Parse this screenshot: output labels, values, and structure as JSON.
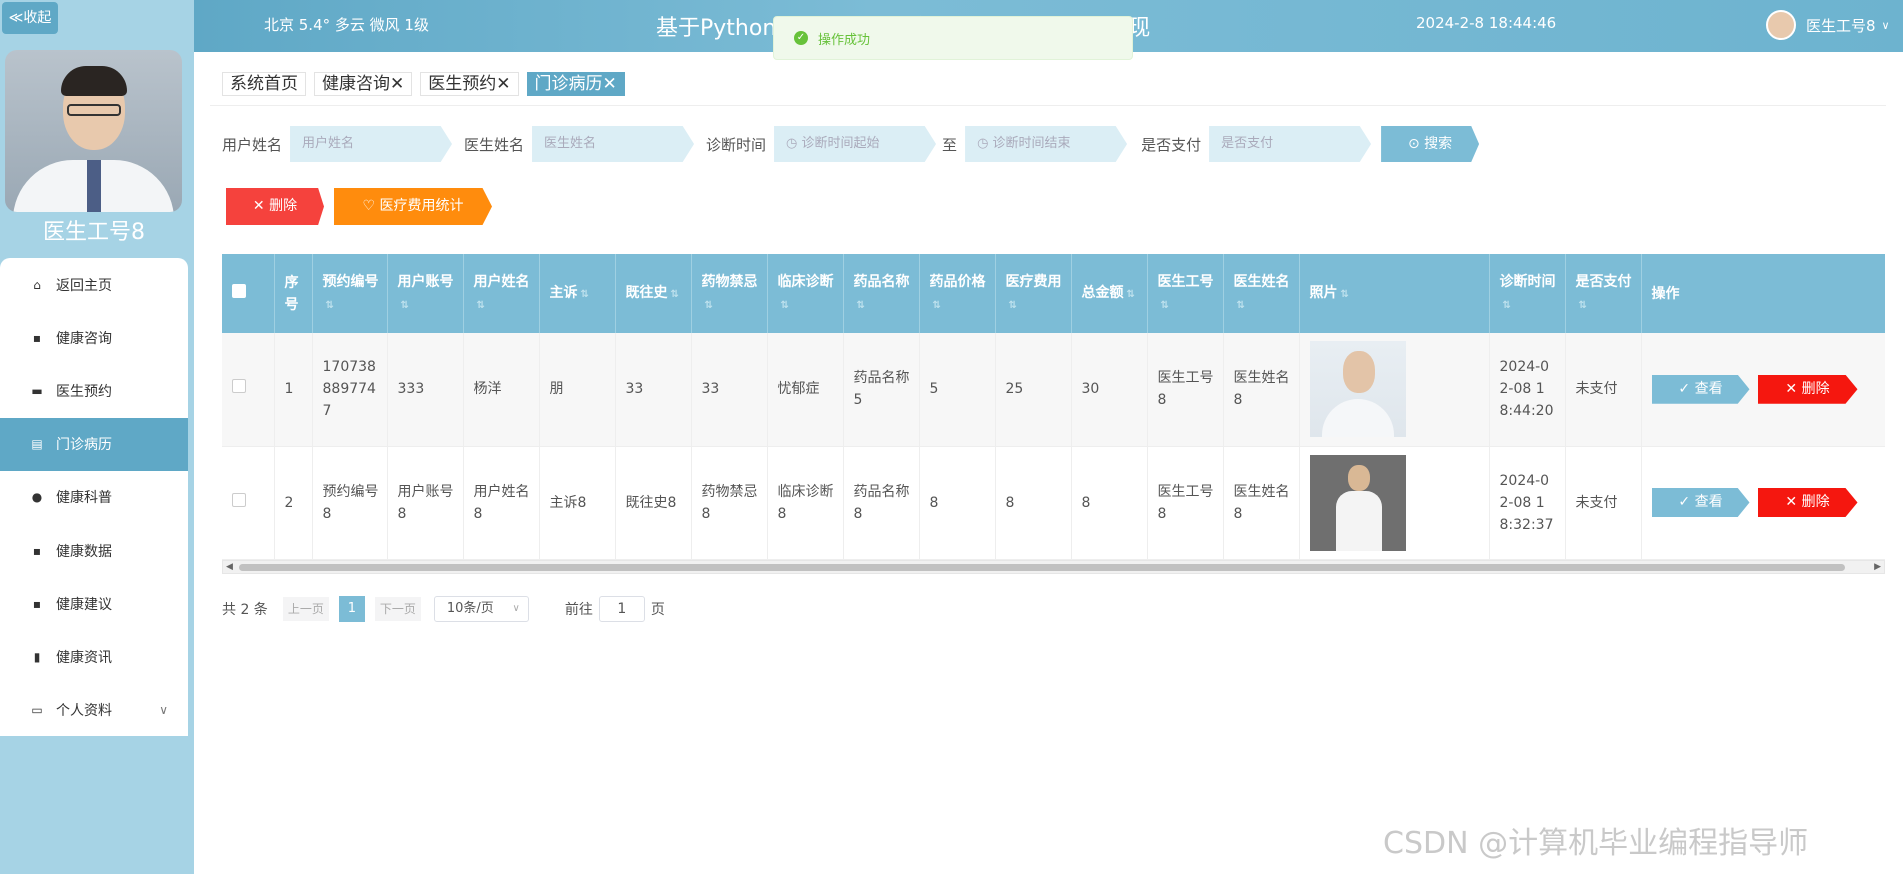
{
  "sidebar": {
    "collapse_label": "≪收起",
    "doctor_name": "医生工号8",
    "items": [
      {
        "label": "返回主页",
        "icon": "home-icon"
      },
      {
        "label": "健康咨询",
        "icon": "grid-icon"
      },
      {
        "label": "医生预约",
        "icon": "monitor-icon"
      },
      {
        "label": "门诊病历",
        "icon": "document-icon",
        "active": true
      },
      {
        "label": "健康科普",
        "icon": "pin-icon"
      },
      {
        "label": "健康数据",
        "icon": "grid-icon"
      },
      {
        "label": "健康建议",
        "icon": "grid-icon"
      },
      {
        "label": "健康资讯",
        "icon": "bar-chart-icon"
      },
      {
        "label": "个人资料",
        "icon": "card-icon"
      }
    ]
  },
  "header": {
    "weather": "北京  5.4°  多云  微风  1级",
    "title": "基于Python的社区医疗健康大数据系统设计与实现",
    "time": "2024-2-8 18:44:46",
    "user": "医生工号8"
  },
  "toast": {
    "text": "操作成功"
  },
  "tabs": [
    {
      "label": "系统首页",
      "closable": false,
      "active": false
    },
    {
      "label": "健康咨询",
      "closable": true,
      "active": false
    },
    {
      "label": "医生预约",
      "closable": true,
      "active": false
    },
    {
      "label": "门诊病历",
      "closable": true,
      "active": true
    }
  ],
  "search": {
    "user_name_label": "用户姓名",
    "user_name_placeholder": "用户姓名",
    "doctor_name_label": "医生姓名",
    "doctor_name_placeholder": "医生姓名",
    "diag_time_label": "诊断时间",
    "diag_start_placeholder": "诊断时间起始",
    "to_label": "至",
    "diag_end_placeholder": "诊断时间结束",
    "paid_label": "是否支付",
    "paid_placeholder": "是否支付",
    "search_button": "搜索"
  },
  "actions": {
    "delete_label": "删除",
    "stats_label": "医疗费用统计"
  },
  "table": {
    "headers": [
      "序号",
      "预约编号",
      "用户账号",
      "用户姓名",
      "主诉",
      "既往史",
      "药物禁忌",
      "临床诊断",
      "药品名称",
      "药品价格",
      "医疗费用",
      "总金额",
      "医生工号",
      "医生姓名",
      "照片",
      "诊断时间",
      "是否支付",
      "操作"
    ],
    "rows": [
      {
        "no": "1",
        "booking_no": "1707388897747",
        "account": "333",
        "user_name": "杨洋",
        "complaint": "朋",
        "history": "33",
        "contraindication": "33",
        "diagnosis": "忧郁症",
        "drug_name": "药品名称5",
        "drug_price": "5",
        "medical_fee": "25",
        "total": "30",
        "doctor_no": "医生工号8",
        "doctor_name": "医生姓名8",
        "diag_time": "2024-02-08 18:44:20",
        "paid": "未支付"
      },
      {
        "no": "2",
        "booking_no": "预约编号8",
        "account": "用户账号8",
        "user_name": "用户姓名8",
        "complaint": "主诉8",
        "history": "既往史8",
        "contraindication": "药物禁忌8",
        "diagnosis": "临床诊断8",
        "drug_name": "药品名称8",
        "drug_price": "8",
        "medical_fee": "8",
        "total": "8",
        "doctor_no": "医生工号8",
        "doctor_name": "医生姓名8",
        "diag_time": "2024-02-08 18:32:37",
        "paid": "未支付"
      }
    ],
    "view_label": "查看",
    "delete_label": "删除"
  },
  "pager": {
    "total": "共 2 条",
    "prev": "上一页",
    "current": "1",
    "next": "下一页",
    "page_size": "10条/页",
    "goto_label": "前往",
    "goto_value": "1",
    "page_suffix": "页"
  },
  "watermark": "CSDN @计算机毕业编程指导师"
}
